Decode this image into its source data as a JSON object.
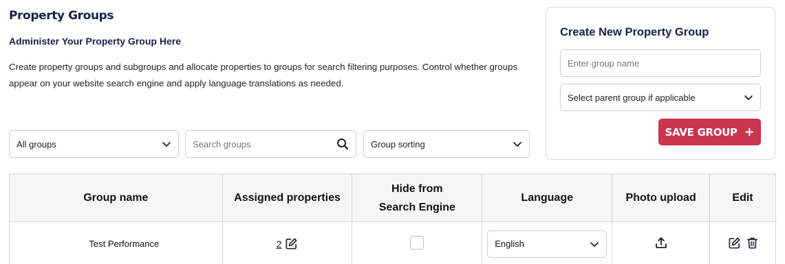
{
  "header": {
    "title": "Property Groups",
    "subtitle": "Administer Your Property Group Here",
    "description": "Create property groups and subgroups and allocate properties to groups for search filtering purposes. Control whether groups appear on your website search engine and apply language translations as needed."
  },
  "filters": {
    "group_filter_value": "All groups",
    "search_placeholder": "Search groups",
    "sorting_value": "Group sorting"
  },
  "create_card": {
    "title": "Create New Property Group",
    "name_placeholder": "Enter group name",
    "parent_value": "Select parent group if applicable",
    "save_label": "SAVE GROUP",
    "save_icon": "+"
  },
  "table": {
    "columns": {
      "group_name": "Group name",
      "assigned": "Assigned properties",
      "hide_line1": "Hide from",
      "hide_line2": "Search Engine",
      "language": "Language",
      "photo": "Photo upload",
      "edit": "Edit"
    },
    "rows": [
      {
        "name": "Test Performance",
        "assigned_count": "2",
        "hidden": false,
        "language": "English"
      }
    ]
  },
  "icons": [
    "chevron-down-icon",
    "search-icon",
    "edit-icon",
    "upload-icon",
    "trash-icon",
    "plus-icon"
  ],
  "colors": {
    "accent": "#c9344f",
    "title": "#1b1f4b",
    "header_bg": "#f6f6f6",
    "border": "#d4d4d4"
  }
}
